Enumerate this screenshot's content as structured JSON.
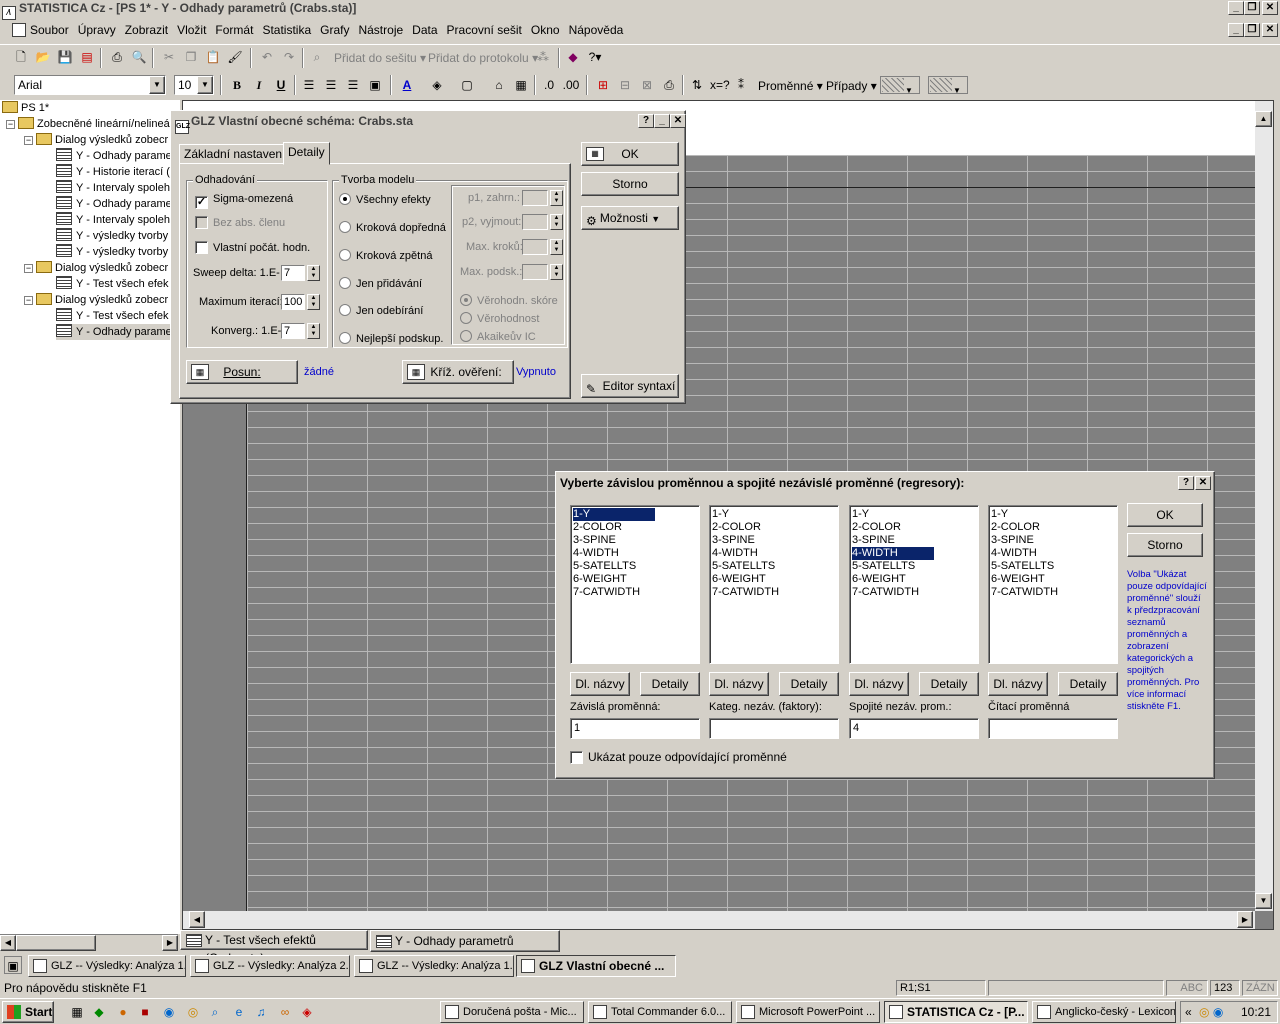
{
  "app": {
    "title": "STATISTICA Cz - [PS 1* - Y - Odhady parametrů (Crabs.sta)]"
  },
  "menu": [
    "Soubor",
    "Úpravy",
    "Zobrazit",
    "Vložit",
    "Formát",
    "Statistika",
    "Grafy",
    "Nástroje",
    "Data",
    "Pracovní sešit",
    "Okno",
    "Nápověda"
  ],
  "toolbar": {
    "add_to_workbook": "Přidat do sešitu",
    "add_to_report": "Přidat do protokolu",
    "font_name": "Arial",
    "font_size": "10",
    "bold": "B",
    "italic": "I",
    "underline": "U",
    "variables": "Proměnné",
    "cases": "Případy"
  },
  "tree": {
    "root": "PS 1*",
    "items": [
      "Zobecněné lineární/nelineá",
      "Dialog výsledků zobecr",
      "Y - Odhady parame",
      "Y - Historie iterací (",
      "Y - Intervaly spoleh",
      "Y - Odhady parame",
      "Y - Intervaly spoleh",
      "Y - výsledky tvorby",
      "Y - výsledky tvorby",
      "Dialog výsledků zobecr",
      "Y - Test všech efek",
      "Dialog výsledků zobecr",
      "Y - Test všech efek",
      "Y - Odhady parame"
    ]
  },
  "glz_dialog": {
    "title": "GLZ Vlastní obecné schéma: Crabs.sta",
    "help": "?",
    "tabs": [
      "Základní nastavení",
      "Detaily"
    ],
    "group_estimation": "Odhadování",
    "sigma": "Sigma-omezená",
    "no_intercept": "Bez abs. členu",
    "custom_init": "Vlastní počát. hodn.",
    "sweep_delta_label": "Sweep delta: 1.E-",
    "sweep_delta_value": "7",
    "max_iter_label": "Maximum iterací:",
    "max_iter_value": "100",
    "converg_label": "Konverg.: 1.E-",
    "converg_value": "7",
    "group_model": "Tvorba modelu",
    "model_options": [
      "Všechny efekty",
      "Kroková dopředná",
      "Kroková zpětná",
      "Jen přidávání",
      "Jen odebírání",
      "Nejlepší podskup."
    ],
    "p1": "p1, zahrn.:",
    "p2": "p2, vyjmout:",
    "max_steps": "Max. kroků:",
    "max_subsets": "Max. podsk.:",
    "score_options": [
      "Věrohodn. skóre",
      "Věrohodnost",
      "Akaikeův IC"
    ],
    "posun_btn": "Posun:",
    "posun_value": "žádné",
    "cross_btn": "Kříž. ověření:",
    "cross_value": "Vypnuto",
    "ok": "OK",
    "cancel": "Storno",
    "options": "Možnosti",
    "syntax": "Editor syntaxí"
  },
  "var_dialog": {
    "title": "Vyberte závislou proměnnou a spojité nezávislé proměnné (regresory):",
    "help": "?",
    "variables": [
      "1-Y",
      "2-COLOR",
      "3-SPINE",
      "4-WIDTH",
      "5-SATELLTS",
      "6-WEIGHT",
      "7-CATWIDTH"
    ],
    "btn_long_names": "Dl. názvy",
    "btn_details": "Detaily",
    "labels": [
      "Závislá proměnná:",
      "Kateg. nezáv. (faktory):",
      "Spojité nezáv. prom.:",
      "Čítací proměnná"
    ],
    "values": [
      "1",
      "",
      "4",
      ""
    ],
    "show_matching": "Ukázat pouze odpovídající proměnné",
    "ok": "OK",
    "cancel": "Storno",
    "help_text": "Volba \"Ukázat pouze odpovídající proměnné\" slouží k předzpracování seznamů proměnných a zobrazení kategorických a spojitých proměnných. Pro více informací stiskněte F1."
  },
  "sheet_tabs": [
    "Y - Test všech efektů (Crabs.sta)",
    "Y - Odhady parametrů (Crabs.sta)"
  ],
  "mdi_tasks": [
    "GLZ -- Výsledky: Analýza 1...",
    "GLZ -- Výsledky: Analýza 2...",
    "GLZ -- Výsledky: Analýza 1...",
    "GLZ Vlastní obecné ..."
  ],
  "status": {
    "help": "Pro nápovědu stiskněte F1",
    "cell": "R1;S1",
    "abc": "ABC",
    "num": "123",
    "mode": "ZÁZN"
  },
  "taskbar": {
    "start": "Start",
    "tasks": [
      "Doručená pošta - Mic...",
      "Total Commander 6.0...",
      "Microsoft PowerPoint ...",
      "STATISTICA Cz - [P...",
      "Anglicko-český - Lexicon"
    ],
    "chevron": "«",
    "clock": "10:21"
  },
  "colors": {
    "selection": "#0a246a",
    "face": "#d4d0c8",
    "link": "#0000cc"
  }
}
